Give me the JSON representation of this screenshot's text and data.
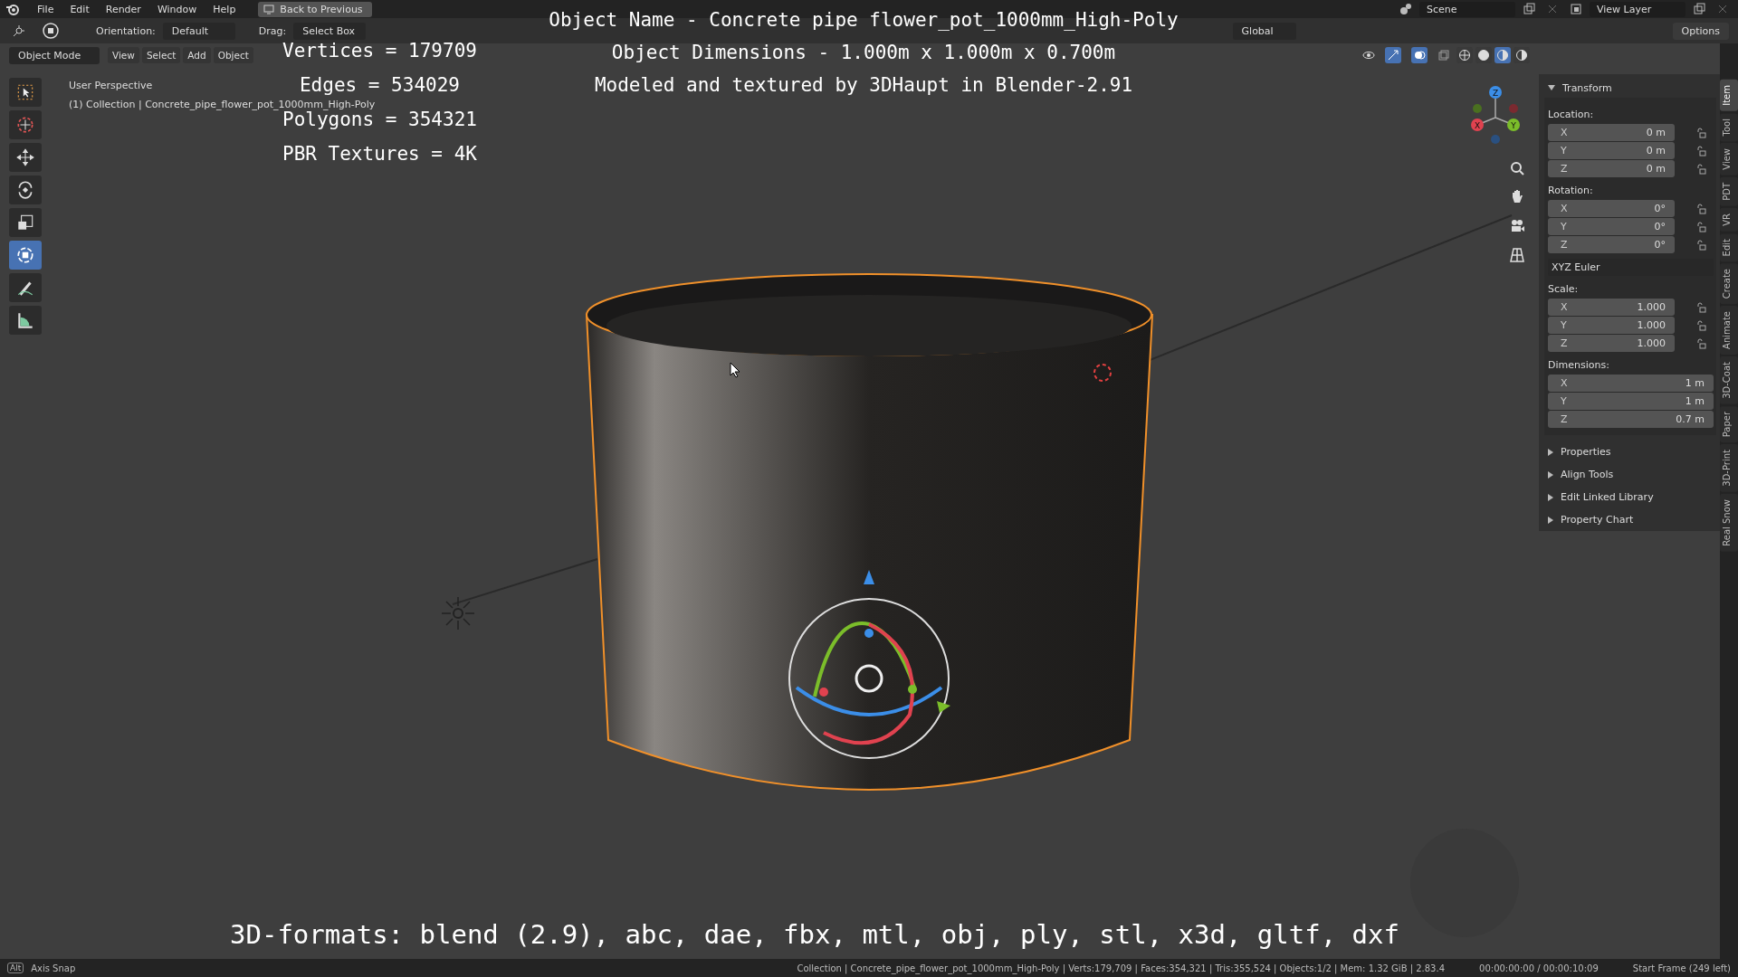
{
  "menu_bar": {
    "items": [
      "File",
      "Edit",
      "Render",
      "Window",
      "Help"
    ],
    "back_button": "Back to Previous",
    "scene": "Scene",
    "view_layer": "View Layer"
  },
  "tool_header": {
    "orientation_label": "Orientation:",
    "orientation": "Default",
    "drag_label": "Drag:",
    "drag": "Select Box",
    "transform_orientation": "Global",
    "options": "Options"
  },
  "view_header": {
    "mode": "Object Mode",
    "menus": [
      "View",
      "Select",
      "Add",
      "Object"
    ],
    "shading": [
      {
        "selected": false
      },
      {
        "selected": false
      },
      {
        "selected": true
      },
      {
        "selected": false
      }
    ]
  },
  "toolbar": [
    {
      "kind": "select",
      "selected": false
    },
    {
      "kind": "cursor",
      "selected": false
    },
    {
      "kind": "move",
      "selected": false
    },
    {
      "kind": "rotate",
      "selected": false
    },
    {
      "kind": "scale",
      "selected": false
    },
    {
      "kind": "transform",
      "selected": true
    },
    {
      "kind": "annotate",
      "selected": false
    },
    {
      "kind": "measure",
      "selected": false
    }
  ],
  "viewport": {
    "perspective": "User Perspective",
    "collection": "(1) Collection | Concrete_pipe_flower_pot_1000mm_High-Poly",
    "gizmo_axes": [
      "X",
      "Y",
      "Z"
    ]
  },
  "captions": {
    "title_lines": [
      "Object Name - Concrete pipe flower_pot_1000mm_High-Poly",
      "Object Dimensions -  1.000m x 1.000m x 0.700m",
      "Modeled and textured by 3DHaupt in Blender-2.91"
    ],
    "stats": [
      "Vertices = 179709",
      "Edges = 534029",
      "Polygons = 354321",
      "PBR Textures = 4K"
    ],
    "formats": "3D-formats: blend (2.9), abc, dae, fbx, mtl, obj, ply, stl, x3d, gltf, dxf"
  },
  "sidebar": {
    "transform": {
      "title": "Transform",
      "expanded": true,
      "groups": [
        {
          "label": "Location:",
          "wide": false,
          "fields": [
            {
              "axis": "X",
              "value": "0 m"
            },
            {
              "axis": "Y",
              "value": "0 m"
            },
            {
              "axis": "Z",
              "value": "0 m"
            }
          ]
        },
        {
          "label": "Rotation:",
          "wide": false,
          "fields": [
            {
              "axis": "X",
              "value": "0°"
            },
            {
              "axis": "Y",
              "value": "0°"
            },
            {
              "axis": "Z",
              "value": "0°"
            }
          ],
          "mode": "XYZ Euler"
        },
        {
          "label": "Scale:",
          "wide": false,
          "fields": [
            {
              "axis": "X",
              "value": "1.000"
            },
            {
              "axis": "Y",
              "value": "1.000"
            },
            {
              "axis": "Z",
              "value": "1.000"
            }
          ]
        },
        {
          "label": "Dimensions:",
          "wide": true,
          "fields": [
            {
              "axis": "X",
              "value": "1 m"
            },
            {
              "axis": "Y",
              "value": "1 m"
            },
            {
              "axis": "Z",
              "value": "0.7 m"
            }
          ]
        }
      ]
    },
    "panels": [
      {
        "title": "Properties",
        "expanded": false
      },
      {
        "title": "Align Tools",
        "expanded": false
      },
      {
        "title": "Edit Linked Library",
        "expanded": false
      },
      {
        "title": "Property Chart",
        "expanded": false
      }
    ],
    "tabs": [
      {
        "label": "Item",
        "selected": true
      },
      {
        "label": "Tool",
        "selected": false
      },
      {
        "label": "View",
        "selected": false
      },
      {
        "label": "PDT",
        "selected": false
      },
      {
        "label": "VR",
        "selected": false
      },
      {
        "label": "Edit",
        "selected": false
      },
      {
        "label": "Create",
        "selected": false
      },
      {
        "label": "Animate",
        "selected": false
      },
      {
        "label": "3D-Coat",
        "selected": false
      },
      {
        "label": "Paper",
        "selected": false
      },
      {
        "label": "3D-Print",
        "selected": false
      },
      {
        "label": "Real Snow",
        "selected": false
      }
    ]
  },
  "status_bar": {
    "key": "Alt",
    "hint": "Axis Snap",
    "stats": "Collection | Concrete_pipe_flower_pot_1000mm_High-Poly | Verts:179,709 | Faces:354,321 | Tris:355,524 | Objects:1/2 | Mem: 1.32 GiB | 2.83.4",
    "time": "00:00:00:00 / 00:00:10:09",
    "frame": "Start Frame (249 left)"
  }
}
